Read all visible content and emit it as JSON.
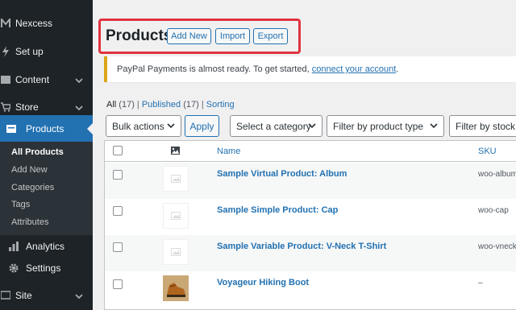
{
  "sidebar": {
    "items": [
      {
        "label": "Nexcess",
        "icon": "nexcess-icon"
      },
      {
        "label": "Set up",
        "icon": "setup-icon"
      },
      {
        "label": "Content",
        "icon": "content-icon"
      },
      {
        "label": "Store",
        "icon": "store-icon"
      },
      {
        "label": "Products",
        "icon": "products-icon"
      },
      {
        "label": "Analytics",
        "icon": "analytics-icon"
      },
      {
        "label": "Settings",
        "icon": "settings-icon"
      },
      {
        "label": "Site",
        "icon": "site-icon"
      }
    ],
    "submenu": [
      "All Products",
      "Add New",
      "Categories",
      "Tags",
      "Attributes"
    ]
  },
  "header": {
    "title": "Products",
    "add_new": "Add New",
    "import": "Import",
    "export": "Export"
  },
  "notice": {
    "text": "PayPal Payments is almost ready. To get started, ",
    "link": "connect your account",
    "end": "."
  },
  "filters": {
    "all": "All",
    "all_count": "(17)",
    "published": "Published",
    "published_count": "(17)",
    "sorting": "Sorting",
    "sep": "|"
  },
  "toolbar": {
    "bulk_actions": "Bulk actions",
    "apply": "Apply",
    "category": "Select a category",
    "product_type": "Filter by product type",
    "stock_status": "Filter by stock st"
  },
  "table": {
    "columns": {
      "name": "Name",
      "sku": "SKU"
    },
    "rows": [
      {
        "name": "Sample Virtual Product: Album",
        "sku": "woo-album"
      },
      {
        "name": "Sample Simple Product: Cap",
        "sku": "woo-cap"
      },
      {
        "name": "Sample Variable Product: V-Neck T-Shirt",
        "sku": "woo-vneck"
      },
      {
        "name": "Voyageur Hiking Boot",
        "sku": "–"
      }
    ]
  },
  "colors": {
    "sidebar": "#1d2327",
    "accent": "#2271b1",
    "highlight": "#e0333e"
  }
}
